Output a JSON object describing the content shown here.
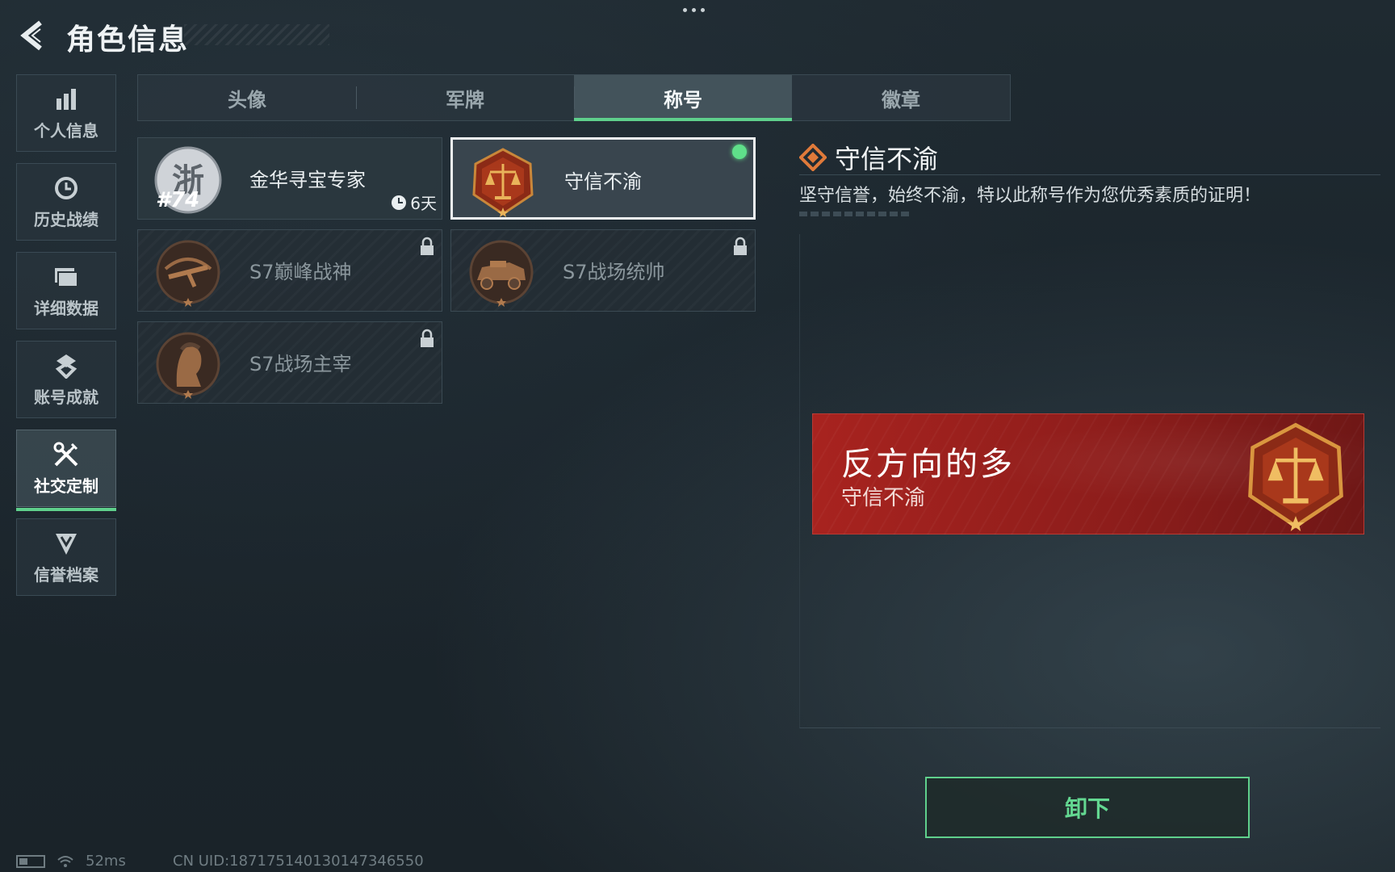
{
  "header": {
    "title": "角色信息"
  },
  "sidebar": {
    "items": [
      {
        "label": "个人信息",
        "icon": "bar-chart-icon",
        "active": false
      },
      {
        "label": "历史战绩",
        "icon": "history-clock-icon",
        "active": false
      },
      {
        "label": "详细数据",
        "icon": "folder-icon",
        "active": false
      },
      {
        "label": "账号成就",
        "icon": "medal-icon",
        "active": false
      },
      {
        "label": "社交定制",
        "icon": "tools-icon",
        "active": true
      },
      {
        "label": "信誉档案",
        "icon": "shield-badge-icon",
        "active": false
      }
    ]
  },
  "tabs": [
    {
      "label": "头像",
      "active": false
    },
    {
      "label": "军牌",
      "active": false
    },
    {
      "label": "称号",
      "active": true
    },
    {
      "label": "徽章",
      "active": false
    }
  ],
  "titles": [
    {
      "name": "金华寻宝专家",
      "emblem": "zhe-emblem-icon",
      "number": "#74",
      "timer": "6天",
      "locked": false,
      "selected": false
    },
    {
      "name": "守信不渝",
      "emblem": "scales-emblem-icon",
      "locked": false,
      "selected": true,
      "equipped": true
    },
    {
      "name": "S7巅峰战神",
      "emblem": "crossbow-emblem-icon",
      "locked": true
    },
    {
      "name": "S7战场统帅",
      "emblem": "vehicle-emblem-icon",
      "locked": true
    },
    {
      "name": "S7战场主宰",
      "emblem": "warrior-emblem-icon",
      "locked": true
    }
  ],
  "detail": {
    "title": "守信不渝",
    "description": "坚守信誉，始终不渝，特以此称号作为您优秀素质的证明！"
  },
  "preview": {
    "player_name": "反方向的多",
    "title": "守信不渝"
  },
  "actions": {
    "unequip_label": "卸下"
  },
  "status_bar": {
    "ping": "52ms",
    "uid": "CN UID:1871751401301473465​50"
  },
  "colors": {
    "accent": "#5fd08c",
    "banner_red": "#a8231f",
    "background": "#1f2a31"
  }
}
